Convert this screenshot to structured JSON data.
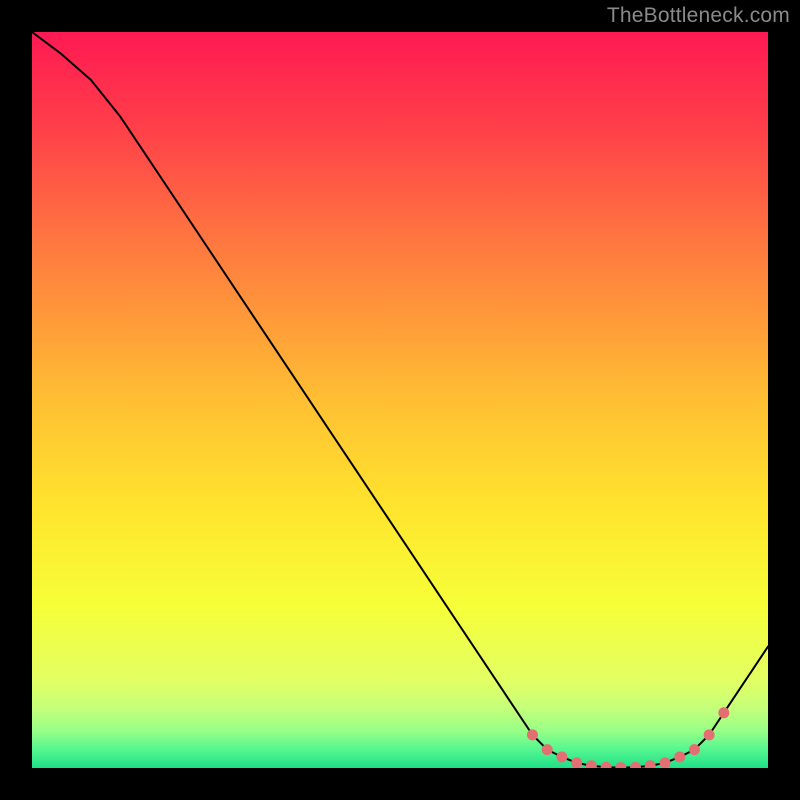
{
  "attribution": "TheBottleneck.com",
  "chart_data": {
    "type": "line",
    "x": [
      0,
      4,
      8,
      12,
      16,
      20,
      24,
      28,
      32,
      36,
      40,
      44,
      48,
      52,
      56,
      60,
      64,
      68,
      70,
      72,
      74,
      76,
      78,
      80,
      82,
      84,
      86,
      88,
      90,
      92,
      94,
      96,
      98,
      100
    ],
    "values": [
      100,
      97,
      93.5,
      88.5,
      82.5,
      76.5,
      70.5,
      64.5,
      58.5,
      52.5,
      46.5,
      40.5,
      34.5,
      28.5,
      22.5,
      16.5,
      10.5,
      4.5,
      2.5,
      1.5,
      0.7,
      0.3,
      0.1,
      0.05,
      0.1,
      0.3,
      0.7,
      1.5,
      2.5,
      4.5,
      7.5,
      10.5,
      13.5,
      16.5
    ],
    "markers_x": [
      68,
      70,
      72,
      74,
      76,
      78,
      80,
      82,
      84,
      86,
      88,
      90,
      92,
      94
    ],
    "marker_color": "#e36f72",
    "line_color": "#000000",
    "line_width": 2,
    "xlabel": "",
    "ylabel": "",
    "xlim": [
      0,
      100
    ],
    "ylim": [
      0,
      100
    ],
    "gradient_stops": [
      {
        "offset": 0,
        "color": "#ff1a53"
      },
      {
        "offset": 0.12,
        "color": "#ff3c4a"
      },
      {
        "offset": 0.3,
        "color": "#ff7c3f"
      },
      {
        "offset": 0.5,
        "color": "#ffbf33"
      },
      {
        "offset": 0.65,
        "color": "#ffe52e"
      },
      {
        "offset": 0.78,
        "color": "#f6ff38"
      },
      {
        "offset": 0.88,
        "color": "#e3ff63"
      },
      {
        "offset": 0.92,
        "color": "#c3ff7a"
      },
      {
        "offset": 0.95,
        "color": "#96ff86"
      },
      {
        "offset": 0.975,
        "color": "#55f691"
      },
      {
        "offset": 1.0,
        "color": "#1ee087"
      }
    ]
  }
}
